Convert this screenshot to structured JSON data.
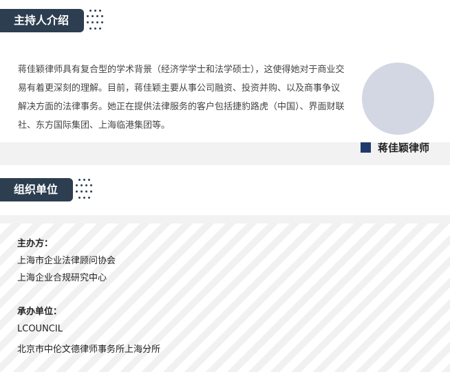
{
  "intro": {
    "heading": "主持人介绍",
    "paragraph": "蒋佳颖律师具有复合型的学术背景（经济学学士和法学硕士），这使得她对于商业交易有着更深刻的理解。目前，蒋佳颖主要从事公司融资、投资并购、以及商事争议解决方面的法律事务。她正在提供法律服务的客户包括捷豹路虎（中国）、界面财联社、东方国际集团、上海临港集团等。",
    "host_name": "蒋佳颖律师"
  },
  "organizers": {
    "heading": "组织单位",
    "host_label": "主办方：",
    "host_orgs": [
      "上海市企业法律顾问协会",
      "上海企业合规研究中心"
    ],
    "undertaker_label": "承办单位：",
    "undertaker_orgs": [
      "LCOUNCIL",
      "北京市中伦文德律师事务所上海分所"
    ]
  },
  "colors": {
    "tag_bg": "#2c3e50",
    "name_marker": "#1f3a6b",
    "avatar": "#d3d7e3",
    "band": "#f2f2f2"
  },
  "icons": {
    "avatar": "avatar-placeholder",
    "decor": "dot-grid-icon"
  }
}
